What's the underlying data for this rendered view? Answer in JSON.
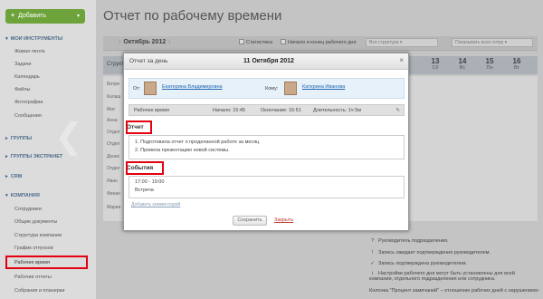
{
  "sidebar": {
    "add_button": "Добавить",
    "sections": [
      {
        "title": "Мои инструменты",
        "items": [
          "Живая лента",
          "Задачи",
          "Календарь",
          "Файлы",
          "Фотографии",
          "Сообщения"
        ]
      },
      {
        "title": "Группы",
        "items": []
      },
      {
        "title": "Группы экстранет",
        "items": []
      },
      {
        "title": "CRM",
        "items": []
      },
      {
        "title": "Компания",
        "items": [
          "Сотрудники",
          "Общие документы",
          "Структура компании",
          "График отпусков",
          "Рабочее время",
          "Рабочие отчеты",
          "Собрания и планерки"
        ]
      }
    ]
  },
  "page": {
    "title": "Отчет по рабочему времени",
    "month": "Октябрь 2012",
    "stats_label": "Статистика",
    "start_label": "Начало и конец рабочего дня",
    "structure_select": "Вся структура",
    "users_select": "Показывать всех сотру",
    "section_stub": "Структ",
    "days": [
      {
        "num": "13",
        "dow": "Сб"
      },
      {
        "num": "14",
        "dow": "Вс"
      },
      {
        "num": "15",
        "dow": "Пн"
      },
      {
        "num": "16",
        "dow": "Вт"
      }
    ],
    "employees": [
      "Битри",
      "Калаш",
      "Мат",
      "Анна",
      "Отдел",
      "Отдел",
      "Денис",
      "Отдел",
      "Иван",
      "Финан",
      "Марин"
    ],
    "legend": [
      {
        "mark": "?",
        "text": "Руководитель подразделения."
      },
      {
        "mark": "!",
        "text": "Запись ожидает подтверждения руководителем."
      },
      {
        "mark": "✓",
        "text": "Запись подтверждена руководителем."
      },
      {
        "mark": "i",
        "text": "Настройки рабочего дня могут быть установлены для всей компании, отдельного подразделения или сотрудника."
      },
      {
        "mark": "",
        "text": "Колонка \"Процент замечаний\" – отношение рабочих дней с нарушением к общему количеству рабочих дней. В колонках \"Рабочих дней\", \"Ра..."
      }
    ]
  },
  "modal": {
    "title": "Отчет за день",
    "date": "11 Октября 2012",
    "from_label": "От:",
    "from_name": "Екатерина Владимировна",
    "to_label": "Кому:",
    "to_name": "Катерина Иванова",
    "work_time_label": "Рабочее время",
    "start": "Начало: 15:45",
    "end": "Окончание: 16:51",
    "duration": "Длительность: 1ч 5м",
    "report_label": "Отчет",
    "report_lines": [
      "1. Подготовила отчет о проделанной работе за месяц",
      "2. Провела презентацию новой системы."
    ],
    "events_label": "События",
    "event_time": "17:00 - 19:00",
    "event_name": "Встреча",
    "add_comment": "Добавить комментарий",
    "save": "Сохранить",
    "close": "Закрыть"
  },
  "colors": {
    "highlight": "#e3000f",
    "link": "#2067b0",
    "add_button": "#6ea33c"
  }
}
